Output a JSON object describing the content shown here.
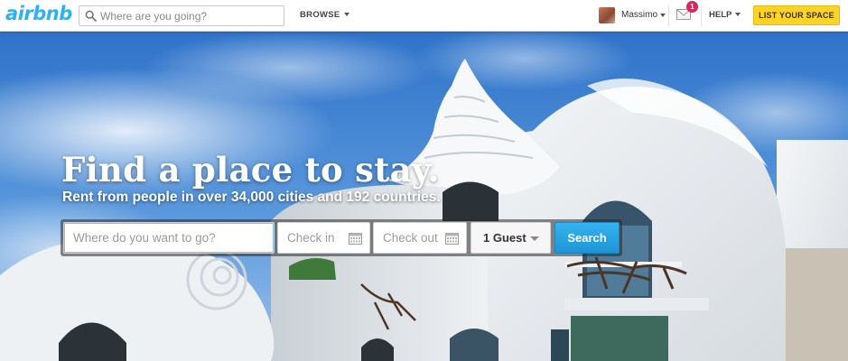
{
  "nav": {
    "logo": "airbnb",
    "search_placeholder": "Where are you going?",
    "browse_label": "BROWSE",
    "user_name": "Massimo",
    "messages_count": "1",
    "help_label": "HELP",
    "list_space_label": "LIST YOUR SPACE"
  },
  "hero": {
    "title": "Find a place to stay.",
    "subtitle": "Rent from people in over 34,000 cities and 192 countries."
  },
  "search": {
    "where_placeholder": "Where do you want to go?",
    "checkin_placeholder": "Check in",
    "checkout_placeholder": "Check out",
    "guests_value": "1 Guest",
    "search_label": "Search"
  },
  "colors": {
    "brand": "#2bb3ef",
    "list_button": "#ffd226",
    "search_button": "#2aa6e6",
    "badge": "#d8275f"
  },
  "icons": [
    "search-icon",
    "chevron-down-icon",
    "mail-icon",
    "calendar-icon"
  ]
}
